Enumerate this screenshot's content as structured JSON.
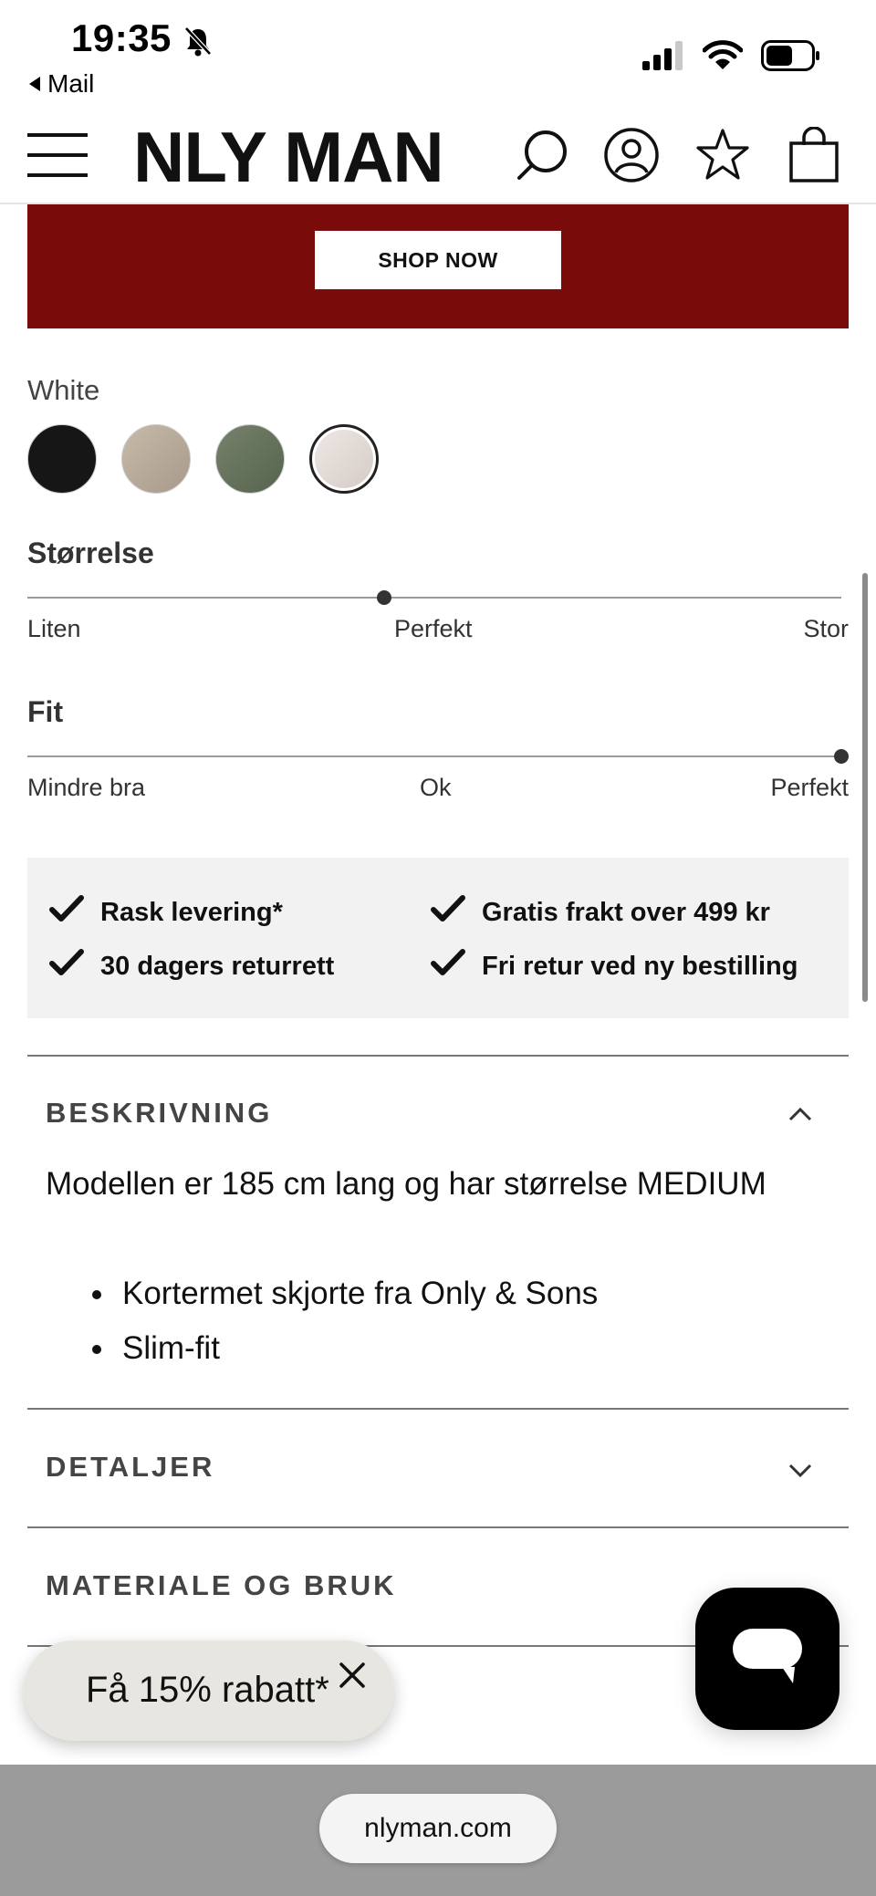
{
  "status_bar": {
    "time": "19:35",
    "back_label": "Mail"
  },
  "header": {
    "logo": "NLY MAN",
    "icons": [
      "menu-icon",
      "search-icon",
      "account-icon",
      "wishlist-star-icon",
      "bag-icon"
    ]
  },
  "banner": {
    "button_label": "SHOP NOW",
    "color": "#7a0b0b"
  },
  "product": {
    "selected_color": "White",
    "swatches": [
      {
        "name": "black",
        "color": "#161616"
      },
      {
        "name": "beige",
        "color": "#b9ab9c"
      },
      {
        "name": "green",
        "color": "#67735c"
      },
      {
        "name": "white",
        "color": "#e4dcd8",
        "selected": true
      }
    ]
  },
  "size_rating": {
    "title": "Størrelse",
    "labels": [
      "Liten",
      "Perfekt",
      "Stor"
    ],
    "value": 0.5
  },
  "fit_rating": {
    "title": "Fit",
    "labels": [
      "Mindre bra",
      "Ok",
      "Perfekt"
    ],
    "value": 1.0
  },
  "usp": {
    "items": [
      "Rask levering*",
      "Gratis frakt over 499 kr",
      "30 dagers returrett",
      "Fri retur ved ny bestilling"
    ]
  },
  "accordion": {
    "description_title": "BESKRIVNING",
    "description_text": "Modellen er 185 cm lang og har størrelse MEDIUM",
    "bullets": [
      "Kortermet skjorte fra Only & Sons",
      "Slim-fit"
    ],
    "details_title": "DETALJER",
    "material_title": "MATERIALE OG BRUK"
  },
  "discount": {
    "label": "Få 15% rabatt*"
  },
  "browser": {
    "url": "nlyman.com"
  }
}
